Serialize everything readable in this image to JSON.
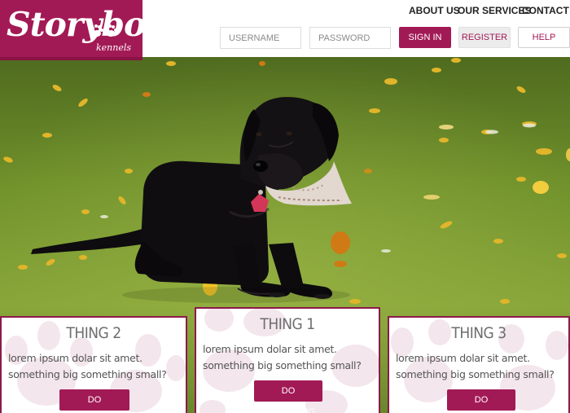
{
  "brand": {
    "name": "Storybook",
    "subtitle": "kennels",
    "color": "#a21a55"
  },
  "nav": {
    "items": [
      "ABOUT US",
      "OUR SERVICES",
      "CONTACT US"
    ]
  },
  "login": {
    "username_placeholder": "USERNAME",
    "password_placeholder": "PASSWORD",
    "signin_label": "SIGN IN",
    "register_label": "REGISTER",
    "help_label": "HELP"
  },
  "cards": [
    {
      "title": "THING 2",
      "text": "lorem ipsum dolar sit amet. something big something small?",
      "button": "DO SOMETHING"
    },
    {
      "title": "THING 1",
      "text": "lorem ipsum dolar sit amet. something big something small?",
      "button": "DO SOMETHING"
    },
    {
      "title": "THING 3",
      "text": "lorem ipsum dolar sit amet. something big something small?",
      "button": "DO SOMETHING"
    }
  ],
  "icons": {
    "logo_paw": "paw-print-icon",
    "card_background": "paw-print-icon"
  }
}
